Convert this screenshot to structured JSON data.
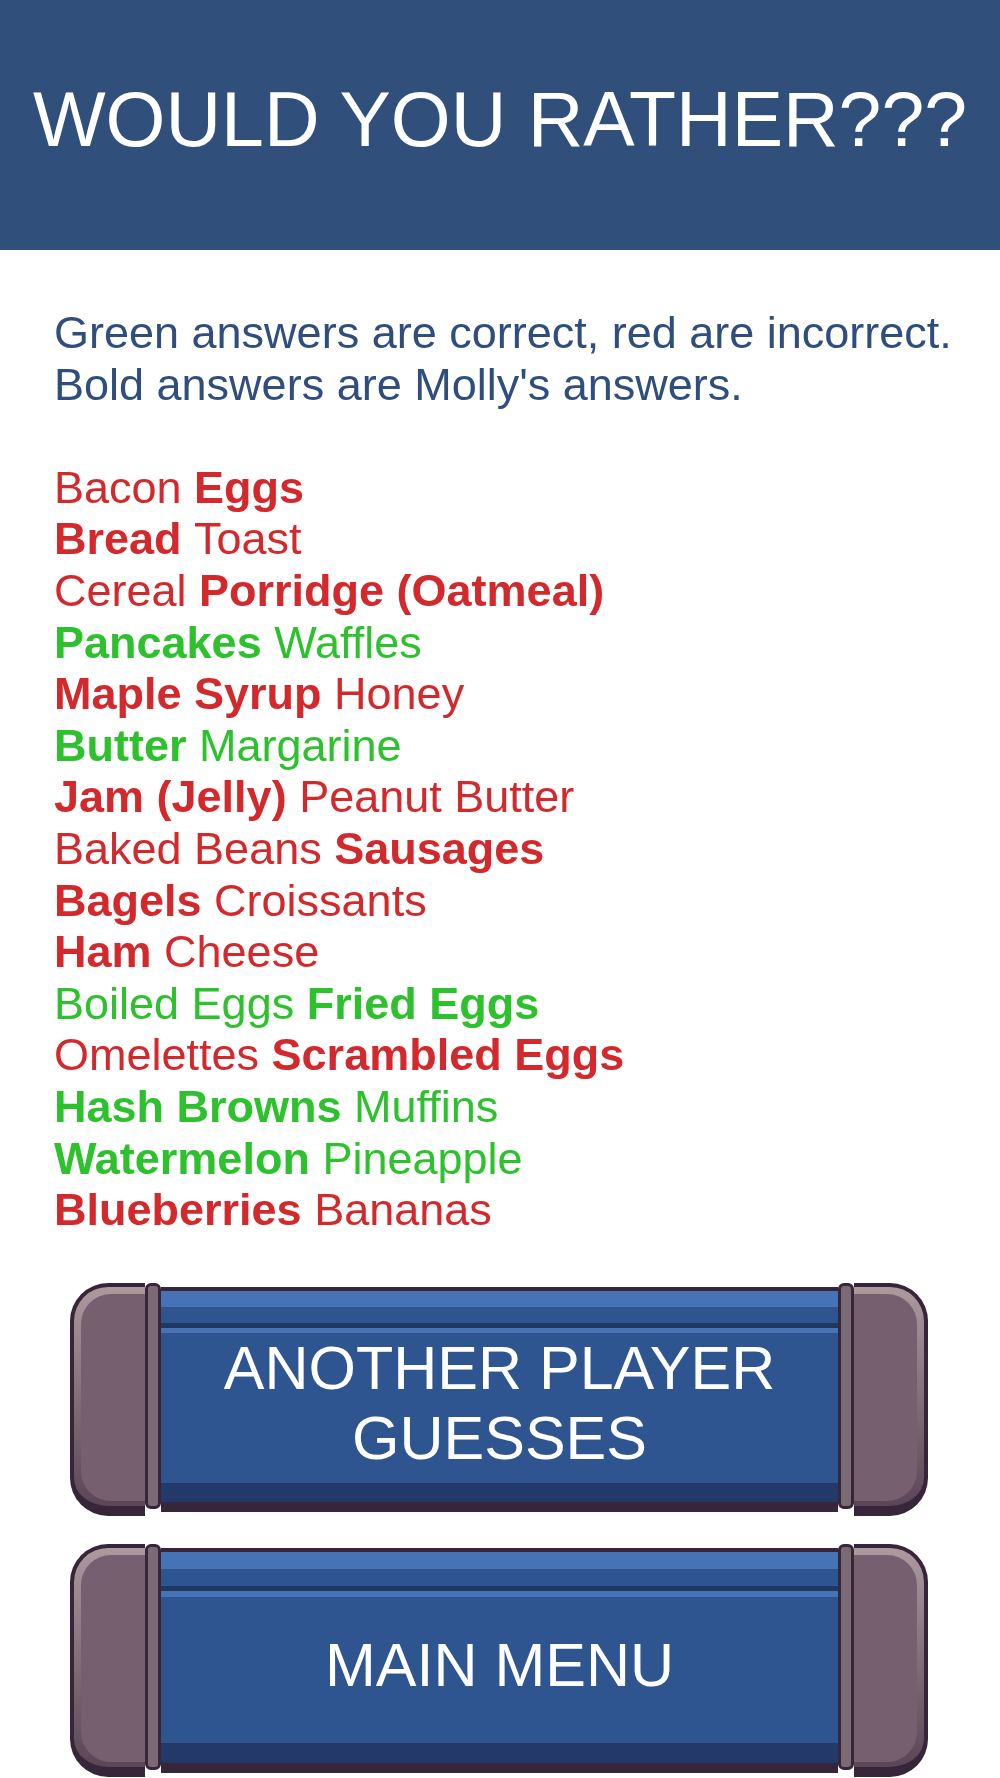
{
  "header": {
    "title": "WOULD YOU RATHER???"
  },
  "legend": [
    "Green answers are correct, red are incorrect.",
    "Bold answers are Molly's answers."
  ],
  "rows": [
    {
      "correct": false,
      "options": [
        {
          "text": "Bacon",
          "selected": false
        },
        {
          "text": "Eggs",
          "selected": true
        }
      ]
    },
    {
      "correct": false,
      "options": [
        {
          "text": "Bread",
          "selected": true
        },
        {
          "text": "Toast",
          "selected": false
        }
      ]
    },
    {
      "correct": false,
      "options": [
        {
          "text": "Cereal",
          "selected": false
        },
        {
          "text": "Porridge (Oatmeal)",
          "selected": true
        }
      ]
    },
    {
      "correct": true,
      "options": [
        {
          "text": "Pancakes",
          "selected": true
        },
        {
          "text": "Waffles",
          "selected": false
        }
      ]
    },
    {
      "correct": false,
      "options": [
        {
          "text": "Maple Syrup",
          "selected": true
        },
        {
          "text": "Honey",
          "selected": false
        }
      ]
    },
    {
      "correct": true,
      "options": [
        {
          "text": "Butter",
          "selected": true
        },
        {
          "text": "Margarine",
          "selected": false
        }
      ]
    },
    {
      "correct": false,
      "options": [
        {
          "text": "Jam (Jelly)",
          "selected": true
        },
        {
          "text": "Peanut Butter",
          "selected": false
        }
      ]
    },
    {
      "correct": false,
      "options": [
        {
          "text": "Baked Beans",
          "selected": false
        },
        {
          "text": "Sausages",
          "selected": true
        }
      ]
    },
    {
      "correct": false,
      "options": [
        {
          "text": "Bagels",
          "selected": true
        },
        {
          "text": "Croissants",
          "selected": false
        }
      ]
    },
    {
      "correct": false,
      "options": [
        {
          "text": "Ham",
          "selected": true
        },
        {
          "text": "Cheese",
          "selected": false
        }
      ]
    },
    {
      "correct": true,
      "options": [
        {
          "text": "Boiled Eggs",
          "selected": false
        },
        {
          "text": "Fried Eggs",
          "selected": true
        }
      ]
    },
    {
      "correct": false,
      "options": [
        {
          "text": "Omelettes",
          "selected": false
        },
        {
          "text": "Scrambled Eggs",
          "selected": true
        }
      ]
    },
    {
      "correct": true,
      "options": [
        {
          "text": "Hash Browns",
          "selected": true
        },
        {
          "text": "Muffins",
          "selected": false
        }
      ]
    },
    {
      "correct": true,
      "options": [
        {
          "text": "Watermelon",
          "selected": true
        },
        {
          "text": "Pineapple",
          "selected": false
        }
      ]
    },
    {
      "correct": false,
      "options": [
        {
          "text": "Blueberries",
          "selected": true
        },
        {
          "text": "Bananas",
          "selected": false
        }
      ]
    }
  ],
  "buttons": [
    "ANOTHER PLAYER GUESSES",
    "MAIN MENU"
  ]
}
